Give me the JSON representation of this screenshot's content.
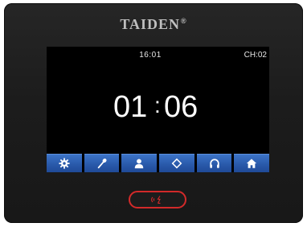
{
  "brand": {
    "name": "TAIDEN",
    "mark": "®"
  },
  "screen": {
    "clock": "16:01",
    "channel": "CH:02",
    "timer": {
      "minutes": "01",
      "separator": ":",
      "seconds": "06"
    }
  },
  "toolbar": {
    "buttons": [
      {
        "icon": "gear-icon"
      },
      {
        "icon": "microphone-icon"
      },
      {
        "icon": "person-icon"
      },
      {
        "icon": "diamond-icon"
      },
      {
        "icon": "headphones-icon"
      },
      {
        "icon": "home-icon"
      }
    ]
  },
  "speak_button": {
    "icon": "speak-icon",
    "accent": "#d22a2a"
  },
  "colors": {
    "accent": "#2a5aab",
    "screen": "#000000",
    "body": "#1c1c1c"
  }
}
